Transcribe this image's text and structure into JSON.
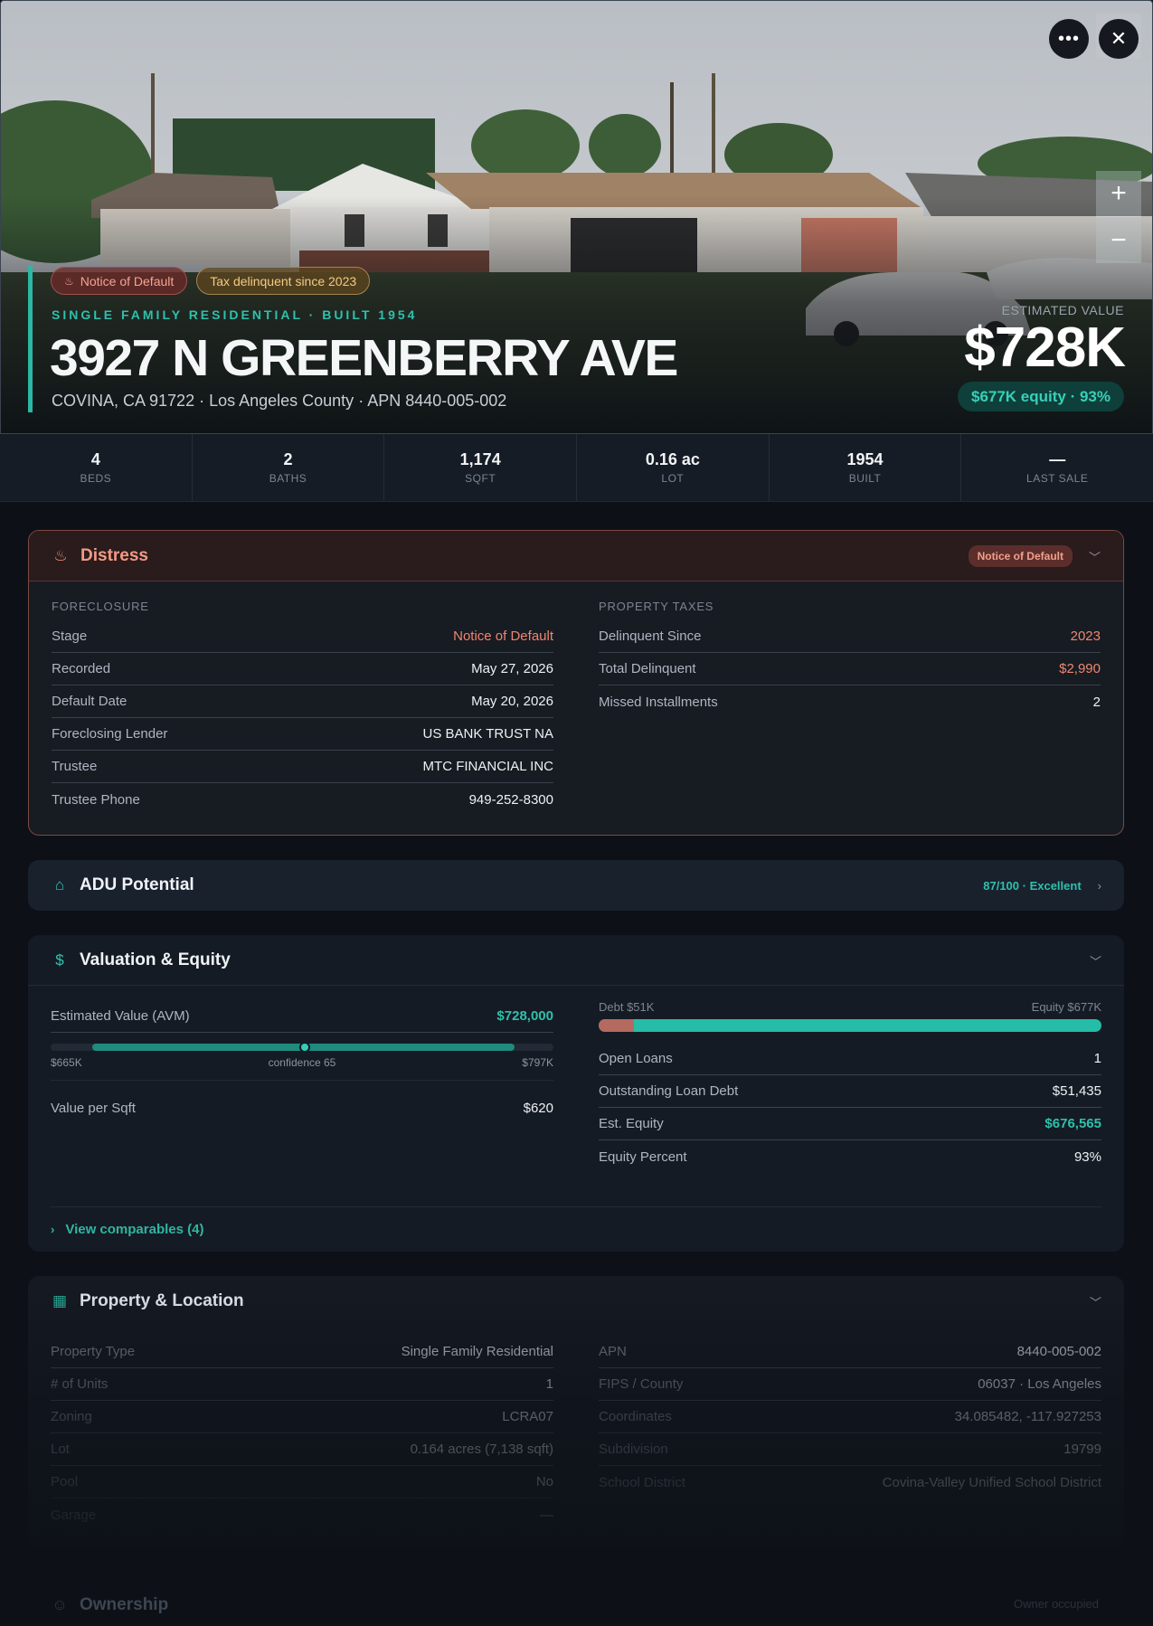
{
  "hero": {
    "badges": [
      {
        "label": "Notice of Default",
        "icon": "flame-icon"
      },
      {
        "label": "Tax delinquent since 2023"
      }
    ],
    "subtype": "SINGLE FAMILY RESIDENTIAL · BUILT 1954",
    "address": "3927 N GREENBERRY AVE",
    "subaddress": "COVINA, CA 91722 · Los Angeles County · APN 8440-005-002",
    "est_label": "ESTIMATED VALUE",
    "est_value": "$728K",
    "equity_pill": "$677K equity · 93%",
    "more_glyph": "•••",
    "close_glyph": "✕",
    "zoom_in": "+",
    "zoom_out": "−"
  },
  "stats": [
    {
      "value": "4",
      "label": "BEDS"
    },
    {
      "value": "2",
      "label": "BATHS"
    },
    {
      "value": "1,174",
      "label": "SQFT"
    },
    {
      "value": "0.16 ac",
      "label": "LOT"
    },
    {
      "value": "1954",
      "label": "BUILT"
    },
    {
      "value": "—",
      "label": "LAST SALE"
    }
  ],
  "distress": {
    "title": "Distress",
    "badge": "Notice of Default",
    "foreclosure_label": "FORECLOSURE",
    "foreclosure": [
      {
        "k": "Stage",
        "v": "Notice of Default"
      },
      {
        "k": "Recorded",
        "v": "May 27, 2026"
      },
      {
        "k": "Default Date",
        "v": "May 20, 2026"
      },
      {
        "k": "Foreclosing Lender",
        "v": "US BANK TRUST NA"
      },
      {
        "k": "Trustee",
        "v": "MTC FINANCIAL INC"
      },
      {
        "k": "Trustee Phone",
        "v": "949-252-8300"
      }
    ],
    "taxes_label": "PROPERTY TAXES",
    "taxes": [
      {
        "k": "Delinquent Since",
        "v": "2023"
      },
      {
        "k": "Total Delinquent",
        "v": "$2,990"
      },
      {
        "k": "Missed Installments",
        "v": "2"
      }
    ]
  },
  "adu": {
    "title": "ADU Potential",
    "score": "87/100 · Excellent"
  },
  "valuation": {
    "title": "Valuation & Equity",
    "avm_label": "Estimated Value (AVM)",
    "avm_value": "$728,000",
    "range_low": "$665K",
    "confidence": "confidence 65",
    "range_high": "$797K",
    "ppsf_label": "Value per Sqft",
    "ppsf_value": "$620",
    "debt_label": "Debt $51K",
    "equity_label": "Equity $677K",
    "debt_fraction": 0.07,
    "rows": [
      {
        "k": "Open Loans",
        "v": "1"
      },
      {
        "k": "Outstanding Loan Debt",
        "v": "$51,435"
      },
      {
        "k": "Est. Equity",
        "v": "$676,565"
      },
      {
        "k": "Equity Percent",
        "v": "93%"
      }
    ],
    "comps_link": "View comparables (4)"
  },
  "property": {
    "title": "Property & Location",
    "left": [
      {
        "k": "Property Type",
        "v": "Single Family Residential"
      },
      {
        "k": "# of Units",
        "v": "1"
      },
      {
        "k": "Zoning",
        "v": "LCRA07"
      },
      {
        "k": "Lot",
        "v": "0.164 acres (7,138 sqft)"
      },
      {
        "k": "Pool",
        "v": "No"
      },
      {
        "k": "Garage",
        "v": "—"
      }
    ],
    "right": [
      {
        "k": "APN",
        "v": "8440-005-002"
      },
      {
        "k": "FIPS / County",
        "v": "06037 · Los Angeles"
      },
      {
        "k": "Coordinates",
        "v": "34.085482, -117.927253"
      },
      {
        "k": "Subdivision",
        "v": "19799"
      },
      {
        "k": "School District",
        "v": "Covina-Valley Unified School District"
      }
    ]
  },
  "ownership": {
    "title": "Ownership",
    "status": "Owner occupied"
  }
}
